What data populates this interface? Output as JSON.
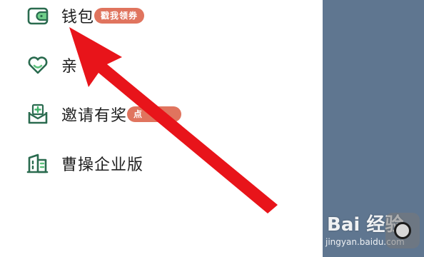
{
  "menu": {
    "items": [
      {
        "label": "钱包",
        "badge": "戳我领券",
        "icon": "wallet-icon"
      },
      {
        "label": "亲",
        "badge": "",
        "icon": "heart-icon"
      },
      {
        "label": "邀请有奖",
        "badge": "点",
        "icon": "invite-envelope-icon"
      },
      {
        "label": "曹操企业版",
        "badge": "",
        "icon": "enterprise-building-icon"
      }
    ]
  },
  "watermark": {
    "brand": "Bai 经验",
    "url": "jingyan.baidu.com"
  },
  "colors": {
    "icon_green": "#2a6b4f",
    "badge": "#e0745e",
    "side_panel": "#5f7690",
    "arrow": "#e8141a"
  }
}
